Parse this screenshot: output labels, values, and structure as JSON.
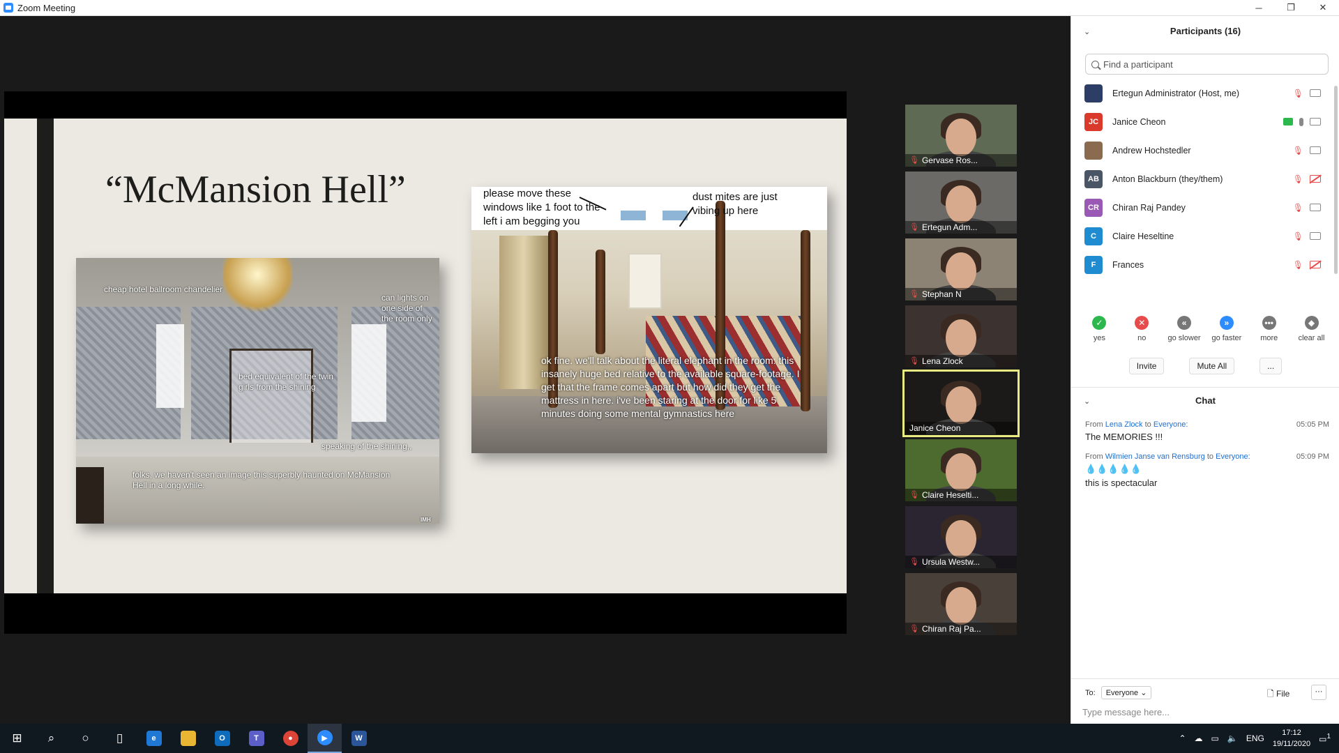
{
  "window": {
    "title": "Zoom Meeting",
    "min": "─",
    "restore": "❐",
    "close": "✕"
  },
  "slide": {
    "title": "“McMansion Hell”",
    "photo1_captions": [
      "cheap hotel ballroom chandelier",
      "can lights on one side of the room only",
      "bed equivalent of the twin girls from the shining",
      "speaking of the shining,,",
      "folks, we haven't seen an image this superbly haunted on McMansion Hell in a long while.",
      "IMH"
    ],
    "photo2_captions": [
      "please move these windows like 1 foot to the left i am begging you",
      "dust mites are just vibing up here",
      "ok fine. we'll talk about the literal elephant in the room: this insanely huge bed relative to the available square-footage. I get that the frame comes apart but how did they get the mattress in here. i've been staring at the door for like 5 minutes doing some mental gymnastics here"
    ]
  },
  "videos": [
    {
      "name": "Gervase Ros...",
      "muted": true
    },
    {
      "name": "Ertegun Adm...",
      "muted": true
    },
    {
      "name": "Stephan N",
      "muted": true
    },
    {
      "name": "Lena Zlock",
      "muted": true
    },
    {
      "name": "Janice Cheon",
      "muted": false,
      "active": true
    },
    {
      "name": "Claire Heselti...",
      "muted": true
    },
    {
      "name": "Ursula Westw...",
      "muted": true
    },
    {
      "name": "Chiran Raj Pa...",
      "muted": true
    }
  ],
  "participants": {
    "title": "Participants (16)",
    "collapse_icon": "⌄",
    "search_placeholder": "Find a participant",
    "list": [
      {
        "name": "Ertegun Administrator (Host, me)",
        "initials": "",
        "color": "#2c3e66",
        "muted": true,
        "video_off": false
      },
      {
        "name": "Janice Cheon",
        "initials": "JC",
        "color": "#d93a2b",
        "muted": false,
        "video_off": false,
        "sharing": true
      },
      {
        "name": "Andrew Hochstedler",
        "initials": "",
        "color": "#8a6b4f",
        "muted": true,
        "video_off": false
      },
      {
        "name": "Anton Blackburn (they/them)",
        "initials": "AB",
        "color": "#4a5565",
        "muted": true,
        "video_off": true
      },
      {
        "name": "Chiran Raj Pandey",
        "initials": "CR",
        "color": "#9b59b6",
        "muted": true,
        "video_off": false
      },
      {
        "name": "Claire Heseltine",
        "initials": "C",
        "color": "#1f8bd1",
        "muted": true,
        "video_off": false
      },
      {
        "name": "Frances",
        "initials": "F",
        "color": "#1f8bd1",
        "muted": true,
        "video_off": true
      }
    ],
    "reactions": [
      {
        "label": "yes",
        "glyph": "✓",
        "color": "#2db84d"
      },
      {
        "label": "no",
        "glyph": "✕",
        "color": "#e84b4b"
      },
      {
        "label": "go slower",
        "glyph": "«",
        "color": "#777"
      },
      {
        "label": "go faster",
        "glyph": "»",
        "color": "#2d8cff"
      },
      {
        "label": "more",
        "glyph": "•••",
        "color": "#777"
      },
      {
        "label": "clear all",
        "glyph": "◆",
        "color": "#777"
      }
    ],
    "invite": "Invite",
    "mute_all": "Mute All",
    "more": "..."
  },
  "chat": {
    "title": "Chat",
    "messages": [
      {
        "prefix": "From",
        "from": "Lena Zlock",
        "to_word": "to",
        "to": "Everyone:",
        "time": "05:05 PM",
        "text": "The MEMORIES !!!"
      },
      {
        "prefix": "From",
        "from": "Wilmien Janse van Rensburg",
        "to_word": "to",
        "to": "Everyone:",
        "time": "05:09 PM",
        "emoji": "💧💧💧💧💧",
        "text": "this is spectacular"
      }
    ],
    "to_label": "To:",
    "to_value": "Everyone",
    "file": "File",
    "more": "···",
    "placeholder": "Type message here..."
  },
  "taskbar": {
    "lang": "ENG",
    "time": "17:12",
    "date": "19/11/2020",
    "notif": "1"
  }
}
